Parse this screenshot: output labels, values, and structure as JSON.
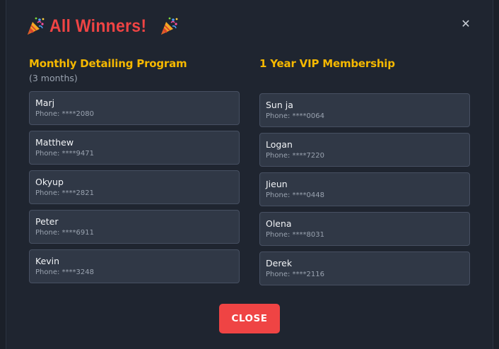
{
  "modal": {
    "title": "All Winners!",
    "title_icon": "party-popper",
    "close_icon": "close-icon",
    "close_glyph": "✕",
    "close_button_label": "CLOSE"
  },
  "prizes": [
    {
      "name": "Monthly Detailing Program",
      "subtitle": "(3 months)",
      "winners": [
        {
          "name": "Marj",
          "phone": "Phone: ****2080"
        },
        {
          "name": "Matthew",
          "phone": "Phone: ****9471"
        },
        {
          "name": "Okyup",
          "phone": "Phone: ****2821"
        },
        {
          "name": "Peter",
          "phone": "Phone: ****6911"
        },
        {
          "name": "Kevin",
          "phone": "Phone: ****3248"
        }
      ]
    },
    {
      "name": "1 Year VIP Membership",
      "winners": [
        {
          "name": "Sun ja",
          "phone": "Phone: ****0064"
        },
        {
          "name": "Logan",
          "phone": "Phone: ****7220"
        },
        {
          "name": "Jieun",
          "phone": "Phone: ****0448"
        },
        {
          "name": "Olena",
          "phone": "Phone: ****8031"
        },
        {
          "name": "Derek",
          "phone": "Phone: ****2116"
        }
      ]
    }
  ],
  "colors": {
    "accent_red": "#ef4444",
    "prize_yellow": "#f5b800",
    "card_bg": "#303846",
    "modal_bg": "#1f2530"
  }
}
